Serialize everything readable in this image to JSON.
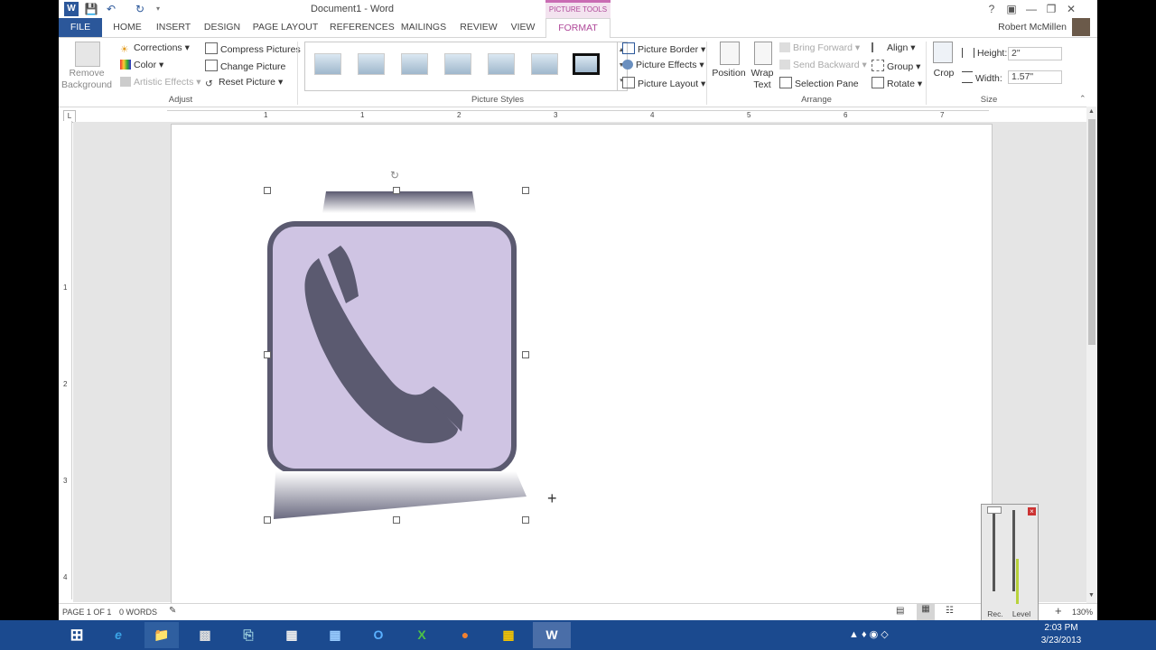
{
  "window": {
    "title": "Document1 - Word",
    "help": "?",
    "user_name": "Robert McMillen",
    "contextual_group": "PICTURE TOOLS"
  },
  "tabs": [
    "FILE",
    "HOME",
    "INSERT",
    "DESIGN",
    "PAGE LAYOUT",
    "REFERENCES",
    "MAILINGS",
    "REVIEW",
    "VIEW",
    "FORMAT"
  ],
  "ribbon": {
    "adjust": {
      "remove_background": "Remove Background",
      "corrections": "Corrections",
      "color": "Color",
      "artistic_effects": "Artistic Effects",
      "compress_pictures": "Compress Pictures",
      "change_picture": "Change Picture",
      "reset_picture": "Reset Picture",
      "label": "Adjust"
    },
    "picture_styles": {
      "picture_border": "Picture Border",
      "picture_effects": "Picture Effects",
      "picture_layout": "Picture Layout",
      "label": "Picture Styles"
    },
    "arrange": {
      "position": "Position",
      "wrap_text": "Wrap Text",
      "bring_forward": "Bring Forward",
      "send_backward": "Send Backward",
      "selection_pane": "Selection Pane",
      "align": "Align",
      "group": "Group",
      "rotate": "Rotate",
      "label": "Arrange"
    },
    "size": {
      "crop": "Crop",
      "height_label": "Height:",
      "height_value": "2\"",
      "width_label": "Width:",
      "width_value": "1.57\"",
      "label": "Size"
    }
  },
  "ruler": {
    "h_numbers": [
      "1",
      "1",
      "2",
      "3",
      "4",
      "5",
      "6",
      "7"
    ],
    "v_numbers": [
      "1",
      "2",
      "3",
      "4"
    ]
  },
  "status": {
    "page": "PAGE 1 OF 1",
    "words": "0 WORDS",
    "zoom": "130%"
  },
  "meter": {
    "rec_vol": "Rec. Vol.",
    "level_meter": "Level Meter"
  },
  "taskbar": {
    "time": "2:03 PM",
    "date": "3/23/2013"
  },
  "colors": {
    "word_blue": "#2b579a",
    "picture_tools_accent": "#b0499a",
    "icon_fill": "#cfc4e3",
    "icon_stroke": "#5b5a70"
  }
}
